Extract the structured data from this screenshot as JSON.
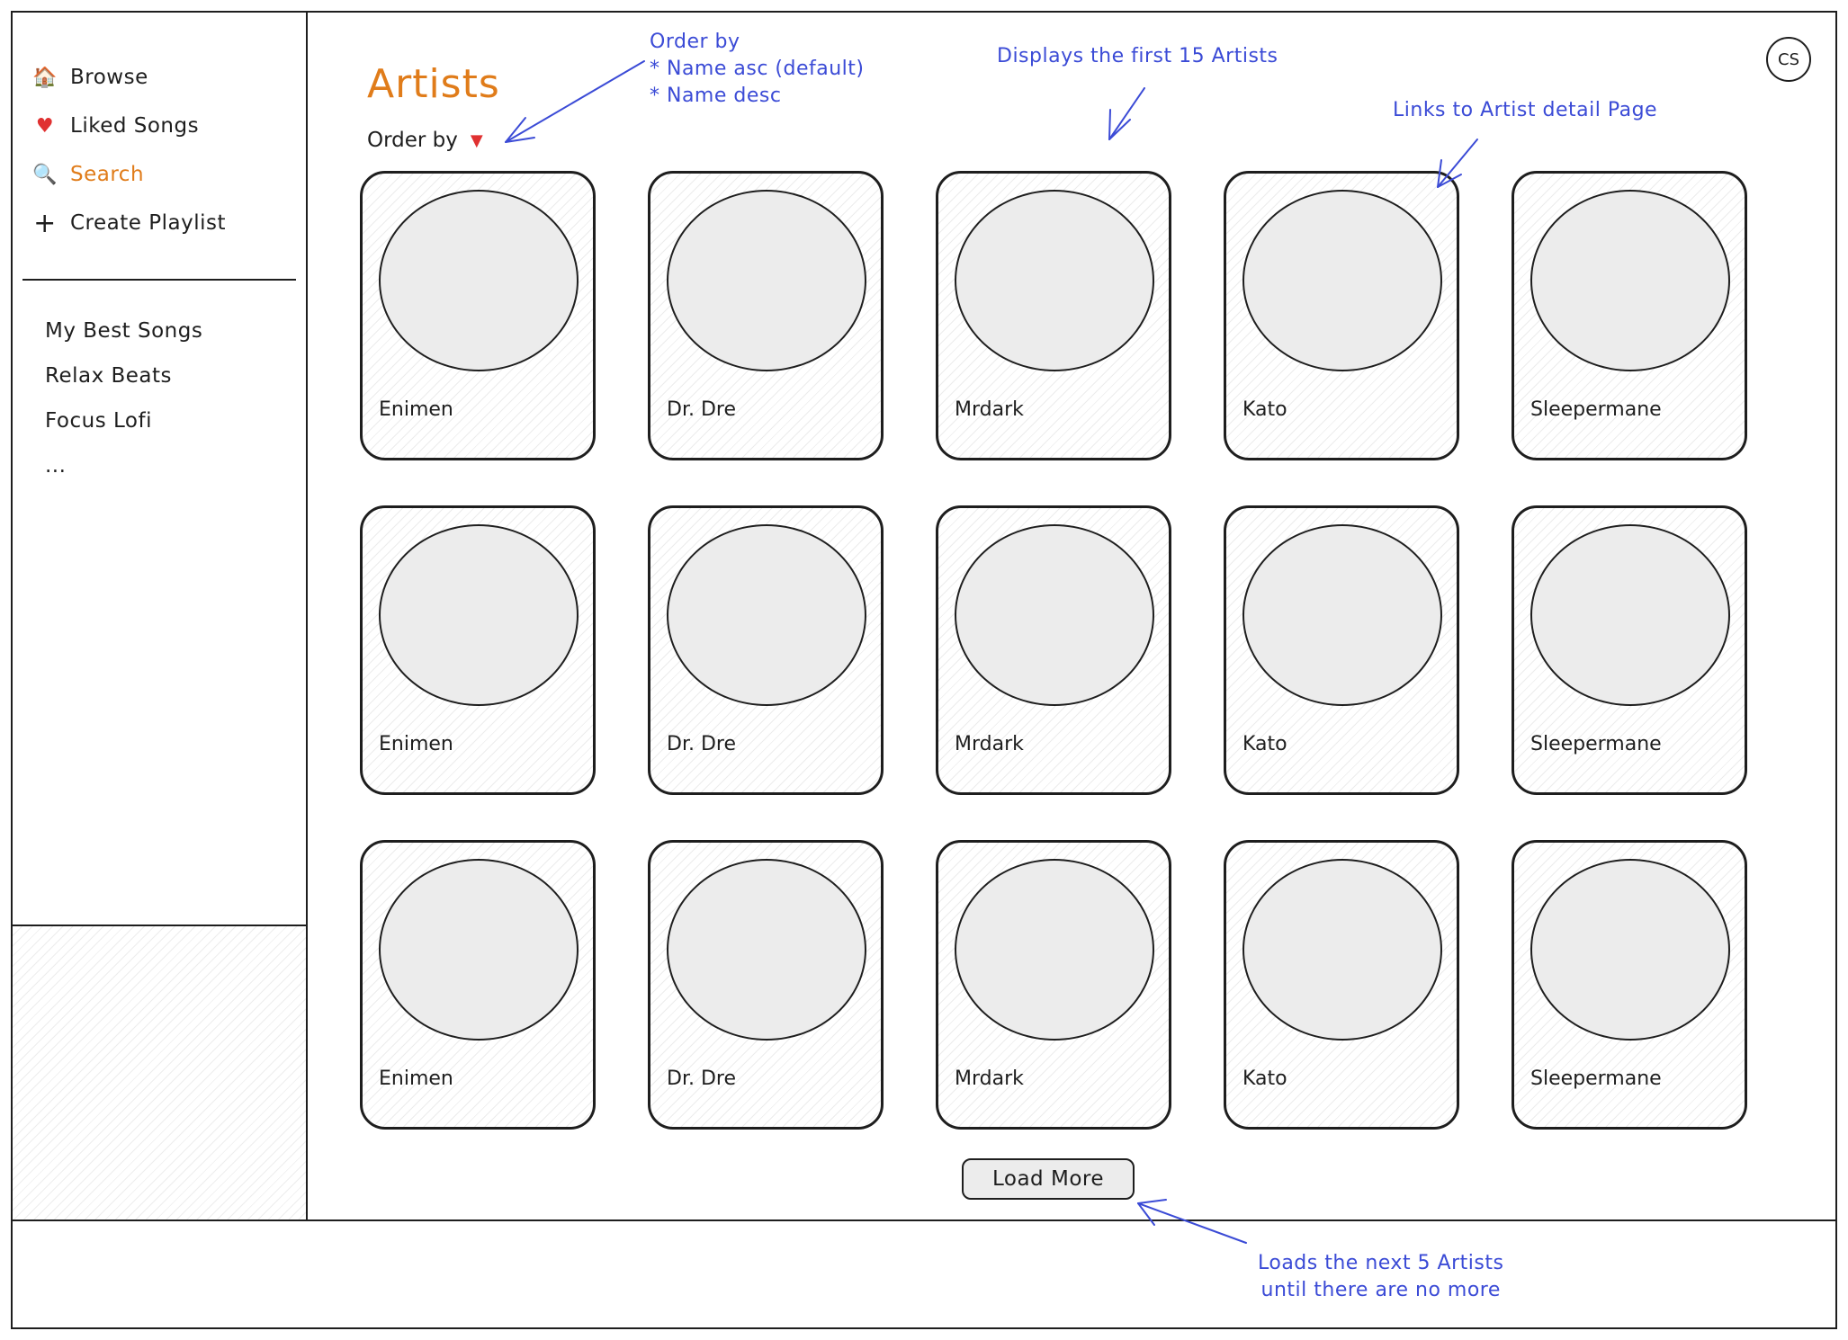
{
  "user": {
    "initials": "CS"
  },
  "nav": {
    "items": [
      {
        "icon": "home-icon",
        "glyph": "🏠",
        "label": "Browse"
      },
      {
        "icon": "heart-icon",
        "glyph": "♥",
        "label": "Liked Songs"
      },
      {
        "icon": "search-icon",
        "glyph": "🔍",
        "label": "Search"
      },
      {
        "icon": "plus-icon",
        "glyph": "+",
        "label": "Create Playlist"
      }
    ]
  },
  "playlists": [
    "My Best Songs",
    "Relax Beats",
    "Focus Lofi",
    "..."
  ],
  "main": {
    "title": "Artists",
    "order_label": "Order by",
    "load_more": "Load More",
    "artists": [
      "Enimen",
      "Dr. Dre",
      "Mrdark",
      "Kato",
      "Sleepermane",
      "Enimen",
      "Dr. Dre",
      "Mrdark",
      "Kato",
      "Sleepermane",
      "Enimen",
      "Dr. Dre",
      "Mrdark",
      "Kato",
      "Sleepermane"
    ]
  },
  "annotations": {
    "order": [
      "Order by",
      "* Name asc (default)",
      "* Name desc"
    ],
    "first15": "Displays the first 15 Artists",
    "links": "Links to Artist detail Page",
    "load": [
      "Loads the next 5 Artists",
      "until there are no more"
    ]
  },
  "colors": {
    "accent": "#e07c1a",
    "annotation": "#3b4bd6",
    "caret": "#e03131",
    "heart": "#e03131"
  }
}
